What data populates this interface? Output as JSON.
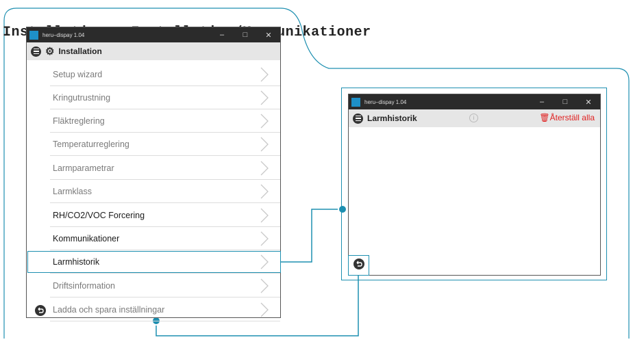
{
  "heading": "Installation → Installation/Kommunikationer",
  "window_main": {
    "title": "heru–dispay 1.04",
    "controls": {
      "minimize": "–",
      "maximize": "□",
      "close": "✕"
    },
    "header_title": "Installation",
    "items": [
      {
        "label": "Setup wizard",
        "state": "disabled"
      },
      {
        "label": "Kringutrustning",
        "state": "disabled"
      },
      {
        "label": "Fläktreglering",
        "state": "disabled"
      },
      {
        "label": "Temperaturreglering",
        "state": "disabled"
      },
      {
        "label": "Larmparametrar",
        "state": "disabled"
      },
      {
        "label": "Larmklass",
        "state": "disabled"
      },
      {
        "label": "RH/CO2/VOC Forcering",
        "state": "active"
      },
      {
        "label": "Kommunikationer",
        "state": "active"
      },
      {
        "label": "Larmhistorik",
        "state": "active"
      },
      {
        "label": "Driftsinformation",
        "state": "disabled"
      },
      {
        "label": "Ladda och spara inställningar",
        "state": "disabled"
      }
    ]
  },
  "window_alarm": {
    "title": "heru–dispay 1.04",
    "controls": {
      "minimize": "–",
      "maximize": "□",
      "close": "✕"
    },
    "header_title": "Larmhistorik",
    "info_icon": "i",
    "reset_label": "Återställ alla"
  },
  "colors": {
    "accent": "#1d8fb0",
    "titlebar": "#2b2b2b",
    "app_icon": "#1e90c8",
    "reset": "#e02020",
    "header_bg": "#e6e6e6"
  }
}
